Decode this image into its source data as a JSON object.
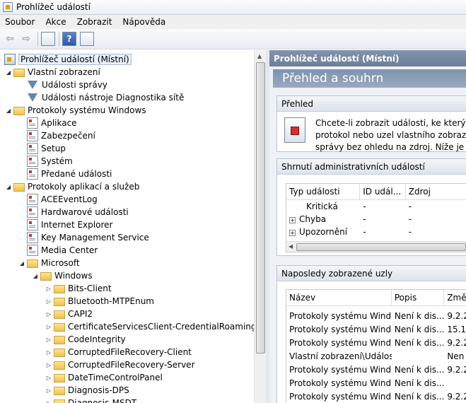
{
  "window": {
    "title": "Prohlížeč událostí"
  },
  "menu": [
    "Soubor",
    "Akce",
    "Zobrazit",
    "Nápověda"
  ],
  "tree": [
    {
      "label": "Prohlížeč událostí (Místní)",
      "level": 0,
      "icon": "root-icon",
      "expander": "",
      "selected": true
    },
    {
      "label": "Vlastní zobrazení",
      "level": 1,
      "icon": "folder-icon",
      "expander": "◢"
    },
    {
      "label": "Události správy",
      "level": 2,
      "icon": "filter-icon",
      "expander": ""
    },
    {
      "label": "Události nástroje Diagnostika sítě",
      "level": 2,
      "icon": "filter-icon",
      "expander": ""
    },
    {
      "label": "Protokoly systému Windows",
      "level": 1,
      "icon": "folder-icon",
      "expander": "◢"
    },
    {
      "label": "Aplikace",
      "level": 2,
      "icon": "log-icon",
      "expander": ""
    },
    {
      "label": "Zabezpečení",
      "level": 2,
      "icon": "log-icon",
      "expander": ""
    },
    {
      "label": "Setup",
      "level": 2,
      "icon": "log-icon",
      "expander": ""
    },
    {
      "label": "Systém",
      "level": 2,
      "icon": "log-icon",
      "expander": ""
    },
    {
      "label": "Předané události",
      "level": 2,
      "icon": "log-icon",
      "expander": ""
    },
    {
      "label": "Protokoly aplikací a služeb",
      "level": 1,
      "icon": "folder-icon",
      "expander": "◢"
    },
    {
      "label": "ACEEventLog",
      "level": 2,
      "icon": "log-icon",
      "expander": ""
    },
    {
      "label": "Hardwarové události",
      "level": 2,
      "icon": "log-icon",
      "expander": ""
    },
    {
      "label": "Internet Explorer",
      "level": 2,
      "icon": "log-icon",
      "expander": ""
    },
    {
      "label": "Key Management Service",
      "level": 2,
      "icon": "log-icon",
      "expander": ""
    },
    {
      "label": "Media Center",
      "level": 2,
      "icon": "log-icon",
      "expander": ""
    },
    {
      "label": "Microsoft",
      "level": 2,
      "icon": "folder-icon",
      "expander": "◢"
    },
    {
      "label": "Windows",
      "level": 3,
      "icon": "folder-icon",
      "expander": "◢"
    },
    {
      "label": "Bits-Client",
      "level": 4,
      "icon": "folder-icon",
      "expander": "▷"
    },
    {
      "label": "Bluetooth-MTPEnum",
      "level": 4,
      "icon": "folder-icon",
      "expander": "▷"
    },
    {
      "label": "CAPI2",
      "level": 4,
      "icon": "folder-icon",
      "expander": "▷"
    },
    {
      "label": "CertificateServicesClient-CredentialRoaming",
      "level": 4,
      "icon": "folder-icon",
      "expander": "▷"
    },
    {
      "label": "CodeIntegrity",
      "level": 4,
      "icon": "folder-icon",
      "expander": "▷"
    },
    {
      "label": "CorruptedFileRecovery-Client",
      "level": 4,
      "icon": "folder-icon",
      "expander": "▷"
    },
    {
      "label": "CorruptedFileRecovery-Server",
      "level": 4,
      "icon": "folder-icon",
      "expander": "▷"
    },
    {
      "label": "DateTimeControlPanel",
      "level": 4,
      "icon": "folder-icon",
      "expander": "▷"
    },
    {
      "label": "Diagnosis-DPS",
      "level": 4,
      "icon": "folder-icon",
      "expander": "▷"
    },
    {
      "label": "Diagnosis-MSDT",
      "level": 4,
      "icon": "folder-icon",
      "expander": "▷"
    }
  ],
  "right": {
    "header": "Prohlížeč událostí (Místní)",
    "title": "Přehled a souhrn",
    "overview": {
      "heading": "Přehled",
      "lines": [
        "Chcete-li zobrazit události, ke kterým do",
        "protokol nebo uzel vlastního zobrazení.",
        "správy bez ohledu na zdroj. Níže je znáz"
      ]
    },
    "admin": {
      "heading": "Shrnutí administrativních událostí",
      "columns": [
        "Typ události",
        "ID udál...",
        "Zdroj"
      ],
      "rows": [
        {
          "type": "Kritická",
          "id": "-",
          "source": "-",
          "expander": ""
        },
        {
          "type": "Chyba",
          "id": "-",
          "source": "-",
          "expander": "+"
        },
        {
          "type": "Upozornění",
          "id": "-",
          "source": "-",
          "expander": "+"
        }
      ]
    },
    "recent": {
      "heading": "Naposledy zobrazené uzly",
      "columns": [
        "Název",
        "Popis",
        "Změ"
      ],
      "rows": [
        {
          "name": "Protokoly systému Wind...",
          "desc": "Není k dis...",
          "mod": "9.2.2"
        },
        {
          "name": "Protokoly systému Wind...",
          "desc": "Není k dis...",
          "mod": "15.1"
        },
        {
          "name": "Protokoly systému Wind...",
          "desc": "Není k dis...",
          "mod": "9.2.2"
        },
        {
          "name": "Vlastní zobrazení\\Události...",
          "desc": "",
          "mod": "Nen"
        },
        {
          "name": "Protokoly systému Wind...",
          "desc": "Není k dis...",
          "mod": "9.2.2"
        },
        {
          "name": "Protokoly systému Wind...",
          "desc": "Není k dis...",
          "mod": ""
        },
        {
          "name": "Protokoly systému Wind...",
          "desc": "Není k dis...",
          "mod": "9.2.2"
        }
      ]
    }
  }
}
